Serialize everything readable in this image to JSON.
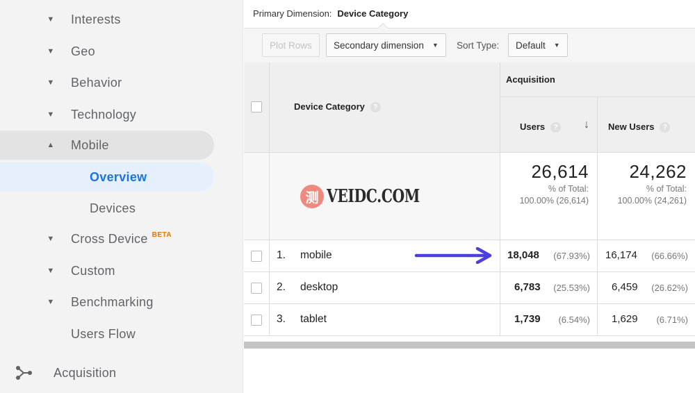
{
  "sidebar": {
    "items": [
      {
        "label": "Interests",
        "caret": "▼"
      },
      {
        "label": "Geo",
        "caret": "▼"
      },
      {
        "label": "Behavior",
        "caret": "▼"
      },
      {
        "label": "Technology",
        "caret": "▼"
      },
      {
        "label": "Mobile",
        "caret": "▲"
      },
      {
        "label": "Overview"
      },
      {
        "label": "Devices"
      },
      {
        "label": "Cross Device",
        "caret": "▼",
        "badge": "BETA"
      },
      {
        "label": "Custom",
        "caret": "▼"
      },
      {
        "label": "Benchmarking",
        "caret": "▼"
      },
      {
        "label": "Users Flow"
      }
    ],
    "acquisition": {
      "label": "Acquisition",
      "icon": "acquisition-icon"
    }
  },
  "primary_dimension": {
    "label": "Primary Dimension:",
    "value": "Device Category"
  },
  "toolbar": {
    "plot_rows": "Plot Rows",
    "secondary_dimension": "Secondary dimension",
    "sort_type_label": "Sort Type:",
    "sort_type_value": "Default"
  },
  "table": {
    "group_header": "Acquisition",
    "col_dimension": "Device Category",
    "col_users": "Users",
    "col_new_users": "New Users",
    "help_glyph": "?",
    "sort_glyph": "↓",
    "totals": {
      "users": "26,614",
      "users_pct_label": "% of Total:",
      "users_pct": "100.00% (26,614)",
      "new_users": "24,262",
      "new_users_pct_label": "% of Total:",
      "new_users_pct": "100.00% (24,261)"
    },
    "rows": [
      {
        "num": "1.",
        "name": "mobile",
        "users": "18,048",
        "users_pct": "(67.93%)",
        "new_users": "16,174",
        "new_users_pct": "(66.66%)"
      },
      {
        "num": "2.",
        "name": "desktop",
        "users": "6,783",
        "users_pct": "(25.53%)",
        "new_users": "6,459",
        "new_users_pct": "(26.62%)"
      },
      {
        "num": "3.",
        "name": "tablet",
        "users": "1,739",
        "users_pct": "(6.54%)",
        "new_users": "1,629",
        "new_users_pct": "(6.71%)"
      }
    ]
  },
  "watermark": {
    "glyph": "测",
    "text": "VEIDC.COM"
  },
  "colors": {
    "accent": "#1a73e8",
    "arrow": "#4a3ee0",
    "beta": "#e37400",
    "watermark_circle": "#f08a7e"
  }
}
